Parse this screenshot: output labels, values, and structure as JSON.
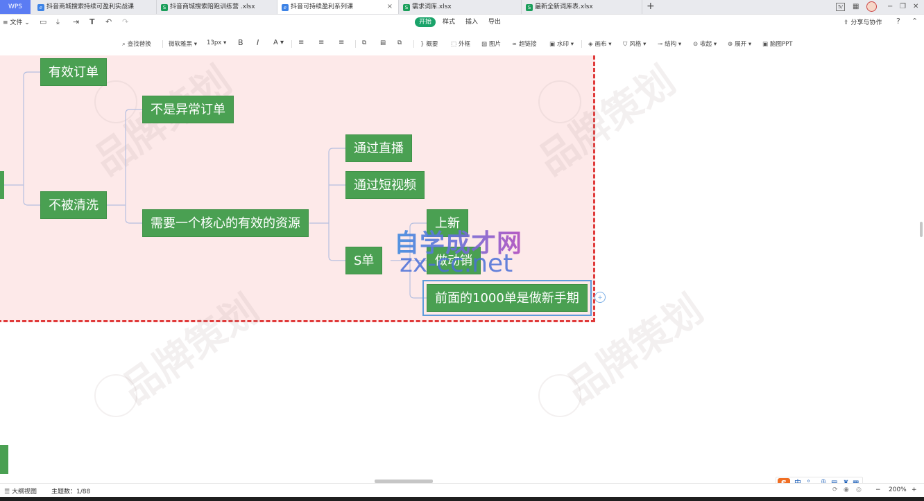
{
  "app": {
    "logo": "WPS"
  },
  "tabs": [
    {
      "label": "抖音商城搜索持续可盈利实战课",
      "kind": "mind",
      "active": false
    },
    {
      "label": "抖音商城搜索陪跑训练营 .xlsx",
      "kind": "sheet",
      "active": false
    },
    {
      "label": "抖音可持续盈利系列课",
      "kind": "mind",
      "active": true
    },
    {
      "label": "需求词库.xlsx",
      "kind": "sheet",
      "active": false
    },
    {
      "label": "最新全新词库表.xlsx",
      "kind": "sheet",
      "active": false
    }
  ],
  "tab_add": "+",
  "tab_close": "×",
  "window_controls": {
    "layout_label": "5/",
    "minimize": "−",
    "restore": "❐",
    "close": "✕"
  },
  "menu": {
    "file": "≡ 文件 ⌄",
    "ribbon_tabs": [
      "开始",
      "样式",
      "插入",
      "导出"
    ],
    "active_tab": "开始",
    "share": "分享与协作",
    "help": "?"
  },
  "toolbar": {
    "find_replace": "查找替换",
    "font": "微软雅黑",
    "font_size": "13px",
    "bold": "B",
    "italic": "I",
    "font_color": "A",
    "summary": "概要",
    "outline_frame": "外框",
    "image": "图片",
    "hyperlink": "超链接",
    "watermark": "水印",
    "layout": "画布",
    "style": "风格",
    "structure": "结构",
    "collapse": "收起",
    "expand": "展开",
    "mind_ppt": "脑图PPT"
  },
  "mindmap": {
    "nodes": {
      "effective_order": "有效订单",
      "not_abnormal": "不是异常订单",
      "not_washed": "不被清洗",
      "core_resource": "需要一个核心的有效的资源",
      "via_live": "通过直播",
      "via_short_video": "通过短视频",
      "s_order": "S单",
      "new_launch": "上新",
      "promotion": "做动销",
      "first_1000": "前面的1000单是做新手期"
    },
    "colors": {
      "node": "#4aa052",
      "frame_bg": "#fde9e9",
      "frame_border": "#e03a3a",
      "line": "#b5bfe0"
    }
  },
  "watermark_overlay": {
    "line1": "自学成才网",
    "line2": "zx-cc.net"
  },
  "status": {
    "outline_view": "大纲视图",
    "topic_count": "主题数：1/88",
    "zoom": "200%",
    "zoom_minus": "−",
    "zoom_plus": "+"
  },
  "ime": {
    "logo": "S",
    "lang": "中",
    "punct": "°,"
  }
}
